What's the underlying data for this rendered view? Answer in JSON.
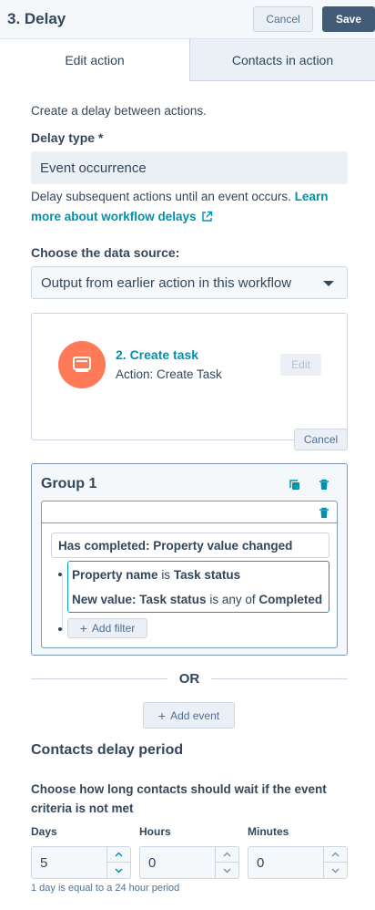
{
  "header": {
    "title": "3. Delay",
    "cancel_label": "Cancel",
    "save_label": "Save"
  },
  "tabs": [
    {
      "label": "Edit action",
      "active": true
    },
    {
      "label": "Contacts in action",
      "active": false
    }
  ],
  "intro_text": "Create a delay between actions.",
  "delay_type": {
    "label": "Delay type *",
    "value": "Event occurrence"
  },
  "delay_description": {
    "text": "Delay subsequent actions until an event occurs.",
    "link_text_1": "Learn",
    "link_text_2": "more about workflow delays"
  },
  "data_source": {
    "label": "Choose the data source:",
    "selected": "Output from earlier action in this workflow"
  },
  "source_card": {
    "title": "2. Create task",
    "subtitle": "Action: Create Task",
    "edit_label": "Edit",
    "icon": "task-icon"
  },
  "card_cancel_label": "Cancel",
  "group": {
    "title": "Group 1",
    "event": "Has completed: Property value changed",
    "filter_1": {
      "prop": "Property name",
      "op": "is",
      "value": "Task status"
    },
    "filter_2": {
      "prop": "New value: Task status",
      "op": "is any of",
      "value": "Completed"
    },
    "add_filter_label": "Add filter"
  },
  "or_label": "OR",
  "add_event_label": "Add event",
  "delay_period": {
    "title": "Contacts delay period",
    "help": "Choose how long contacts should wait if the event criteria is not met",
    "days_label": "Days",
    "days_value": "5",
    "hours_label": "Hours",
    "hours_value": "0",
    "minutes_label": "Minutes",
    "minutes_value": "0",
    "footnote": "1 day is equal to a 24 hour period"
  },
  "colors": {
    "accent": "#0091ae",
    "primary_button": "#425b76",
    "task_icon_bg": "#ff7a59",
    "filter_border": "#00a4bd"
  }
}
